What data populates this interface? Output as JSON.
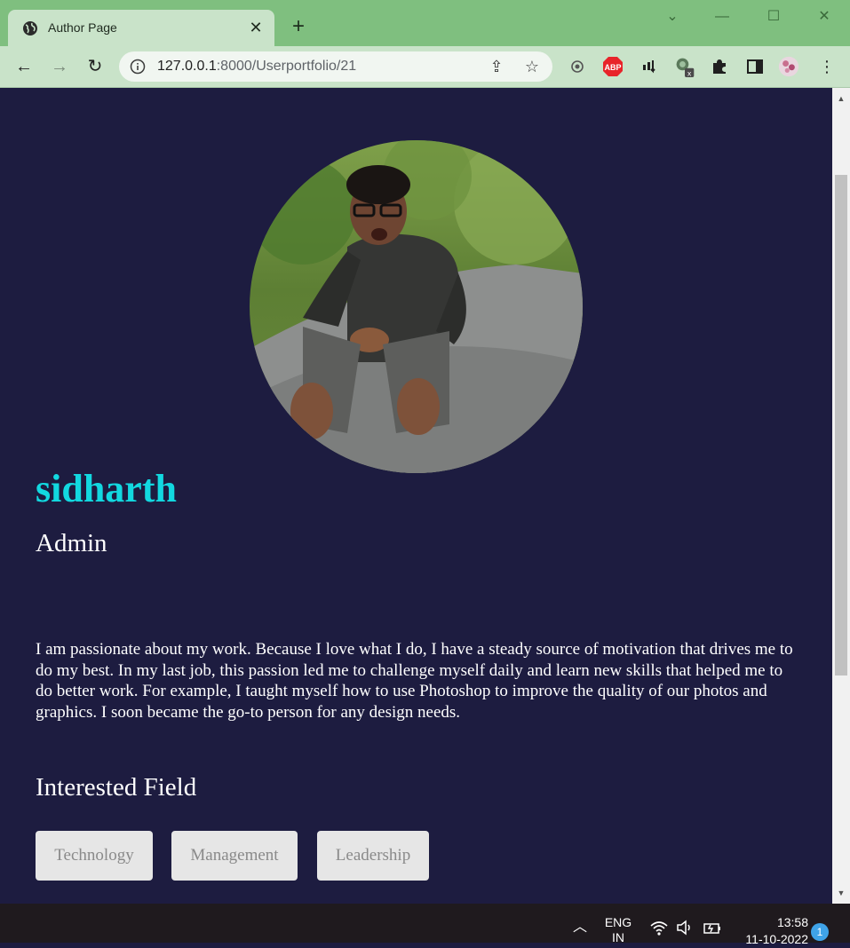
{
  "browser": {
    "tab_title": "Author Page",
    "tab_close": "✕",
    "new_tab": "+",
    "url_host": "127.0.0.1",
    "url_path": ":8000/Userportfolio/21",
    "window_controls": [
      "minimize-icon",
      "maximize-icon",
      "close-icon"
    ],
    "extensions": [
      "lens-icon",
      "adblock-icon",
      "tab-icon",
      "profile-switcher-icon",
      "puzzle-icon",
      "sidepanel-icon",
      "avatar-icon",
      "menu-icon"
    ],
    "adblock_label": "ABP"
  },
  "profile": {
    "name": "sidharth",
    "role": "Admin",
    "bio": "I am passionate about my work. Because I love what I do, I have a steady source of motivation that drives me to do my best. In my last job, this passion led me to challenge myself daily and learn new skills that helped me to do better work. For example, I taught myself how to use Photoshop to improve the quality of our photos and graphics. I soon became the go-to person for any design needs.",
    "interest_heading": "Interested Field",
    "interests": [
      "Technology",
      "Management",
      "Leadership"
    ]
  },
  "colors": {
    "page_bg": "#1d1c40",
    "name_color": "#12d8e0",
    "chrome_green": "#7fbf7f",
    "chip_bg": "#e6e6e6"
  },
  "taskbar": {
    "language_top": "ENG",
    "language_bottom": "IN",
    "time": "13:58",
    "date": "11-10-2022",
    "notification_count": "1"
  }
}
